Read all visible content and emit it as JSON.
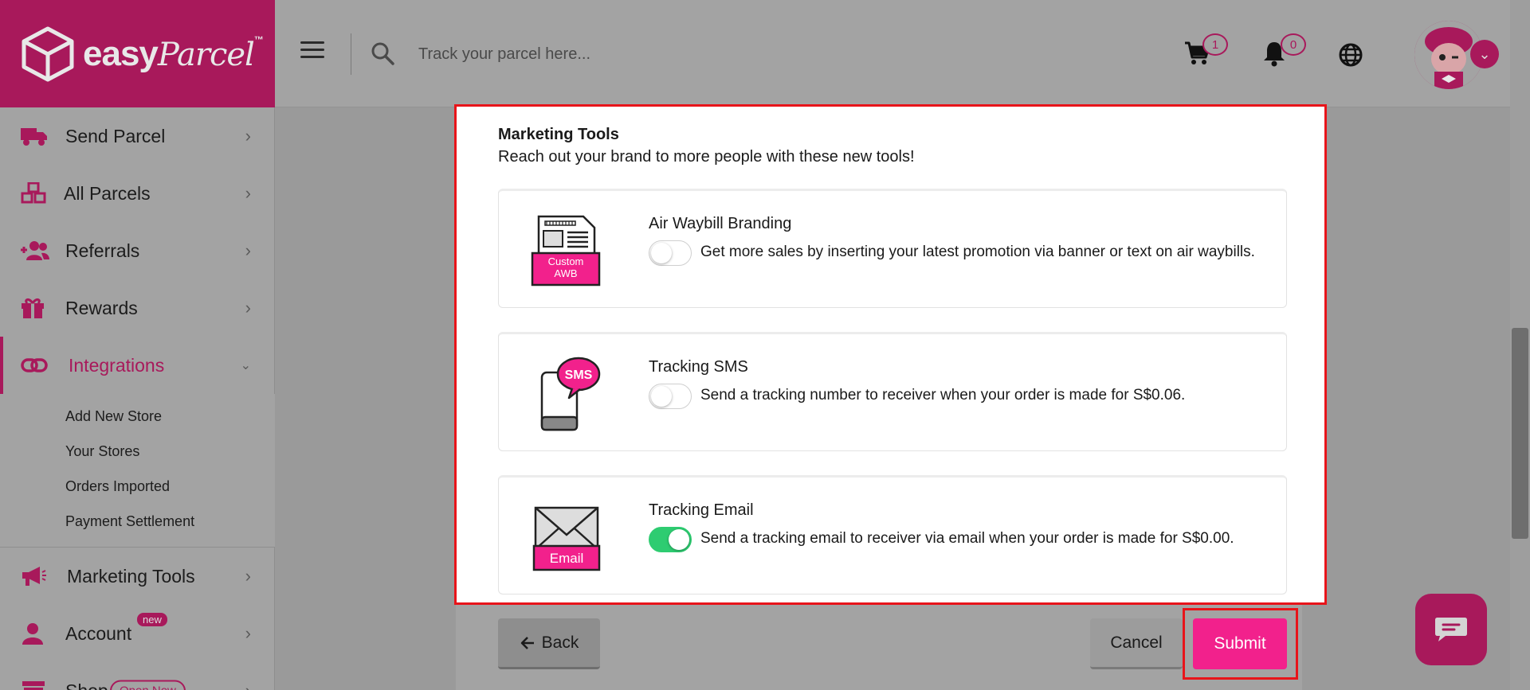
{
  "brand": {
    "logo_word": "easy",
    "logo_script": "Parcel",
    "logo_tm": "™",
    "primary_color": "#a8195b",
    "accent_pink": "#f2218c"
  },
  "sidebar": {
    "items": [
      {
        "label": "Send Parcel",
        "icon": "truck-icon"
      },
      {
        "label": "All Parcels",
        "icon": "boxes-icon"
      },
      {
        "label": "Referrals",
        "icon": "users-plus-icon"
      },
      {
        "label": "Rewards",
        "icon": "gift-icon"
      },
      {
        "label": "Integrations",
        "icon": "link-icon"
      },
      {
        "label": "Marketing Tools",
        "icon": "megaphone-icon"
      },
      {
        "label": "Account",
        "icon": "user-icon"
      },
      {
        "label": "Shop",
        "icon": "store-icon"
      }
    ],
    "sub_items": [
      "Add New Store",
      "Your Stores",
      "Orders Imported",
      "Payment Settlement"
    ],
    "account_badge": "new",
    "shop_badge": "Open Now"
  },
  "header": {
    "search_placeholder": "Track your parcel here...",
    "cart_count": "1",
    "notification_count": "0"
  },
  "panel": {
    "title": "Marketing Tools",
    "subtitle": "Reach out your brand to more people with these new tools!",
    "tools": [
      {
        "name": "Air Waybill Branding",
        "description": "Get more sales by inserting your latest promotion via banner or text on air waybills.",
        "enabled": false,
        "icon_text_1": "Custom",
        "icon_text_2": "AWB"
      },
      {
        "name": "Tracking SMS",
        "description": "Send a tracking number to receiver when your order is made for S$0.06.",
        "enabled": false,
        "icon_text_1": "SMS"
      },
      {
        "name": "Tracking Email",
        "description": "Send a tracking email to receiver via email when your order is made for S$0.00.",
        "enabled": true,
        "icon_text_1": "Email"
      }
    ]
  },
  "buttons": {
    "back": "Back",
    "cancel": "Cancel",
    "submit": "Submit"
  }
}
